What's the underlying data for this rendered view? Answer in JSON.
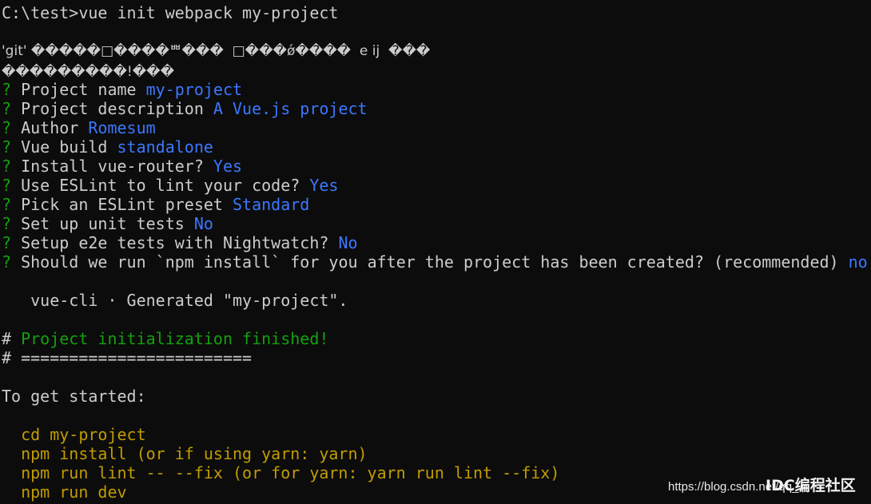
{
  "terminal": {
    "command_line": {
      "prompt": "C:\\test>",
      "command": "vue init webpack my-project"
    },
    "garbled_line_1": "'git' �����□����ᄈ���  □���ǿ����  e ij  ���",
    "garbled_line_2": "���������!���",
    "questions": [
      {
        "mark": "?",
        "label": " Project name ",
        "answer": "my-project"
      },
      {
        "mark": "?",
        "label": " Project description ",
        "answer": "A Vue.js project"
      },
      {
        "mark": "?",
        "label": " Author ",
        "answer": "Romesum"
      },
      {
        "mark": "?",
        "label": " Vue build ",
        "answer": "standalone"
      },
      {
        "mark": "?",
        "label": " Install vue-router? ",
        "answer": "Yes"
      },
      {
        "mark": "?",
        "label": " Use ESLint to lint your code? ",
        "answer": "Yes"
      },
      {
        "mark": "?",
        "label": " Pick an ESLint preset ",
        "answer": "Standard"
      },
      {
        "mark": "?",
        "label": " Set up unit tests ",
        "answer": "No"
      },
      {
        "mark": "?",
        "label": " Setup e2e tests with Nightwatch? ",
        "answer": "No"
      },
      {
        "mark": "?",
        "label": " Should we run `npm install` for you after the project has been created? (recommended) ",
        "answer": "no"
      }
    ],
    "generated": "   vue-cli · Generated \"my-project\".",
    "finished": {
      "hash": "#",
      "text": " Project initialization finished!"
    },
    "separator": {
      "hash": "#",
      "text": " ========================"
    },
    "get_started": "To get started:",
    "steps": [
      "  cd my-project",
      "  npm install (or if using yarn: yarn)",
      "  npm run lint -- --fix (or for yarn: yarn run lint --fix)",
      "  npm run dev"
    ],
    "watermark": {
      "url": "https://blog.csdn.net/qq_",
      "logo": "IDC编程社区"
    }
  }
}
